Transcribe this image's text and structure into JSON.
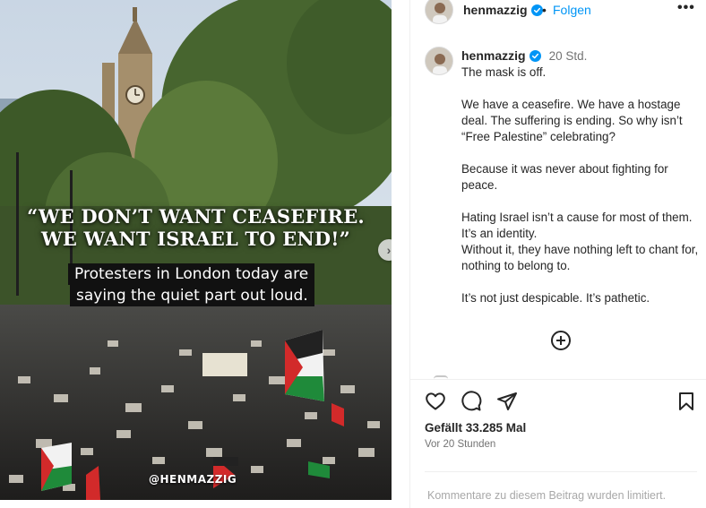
{
  "post_image": {
    "quote_line1": "“WE DON’T WANT CEASEFIRE.",
    "quote_line2": "WE WANT ISRAEL TO END!”",
    "caption_line1": "Protesters in London today are",
    "caption_line2": "saying the quiet part out loud.",
    "watermark": "@HENMAZZIG",
    "next_button_icon": "chevron-right-icon"
  },
  "header": {
    "username": "henmazzig",
    "separator": "•",
    "follow_label": "Folgen",
    "more_icon": "more-options-icon",
    "more_label": "•••"
  },
  "caption": {
    "username": "henmazzig",
    "time": "20 Std.",
    "paragraphs": [
      "The mask is off.",
      "We have a ceasefire. We have a hostage deal. The suffering is ending. So why isn’t “Free Palestine” celebrating?",
      "Because it was never about fighting for peace.",
      "Hating Israel isn’t a cause for most of them. It’s an identity.\nWithout it, they have nothing left to chant for, nothing to belong to.",
      "It’s not just despicable. It’s pathetic."
    ]
  },
  "load_more_icon": "plus-circle-icon",
  "actions": {
    "like_icon": "heart-icon",
    "comment_icon": "comment-icon",
    "share_icon": "send-icon",
    "save_icon": "bookmark-icon"
  },
  "likes": "Gefällt 33.285 Mal",
  "posted": "Vor 20 Stunden",
  "comments_limited": "Kommentare zu diesem Beitrag wurden limitiert.",
  "colors": {
    "verified_blue": "#0095f6",
    "follow_blue": "#0095f6",
    "flag_green": "#1f8a3a",
    "flag_red": "#d22a2a"
  }
}
